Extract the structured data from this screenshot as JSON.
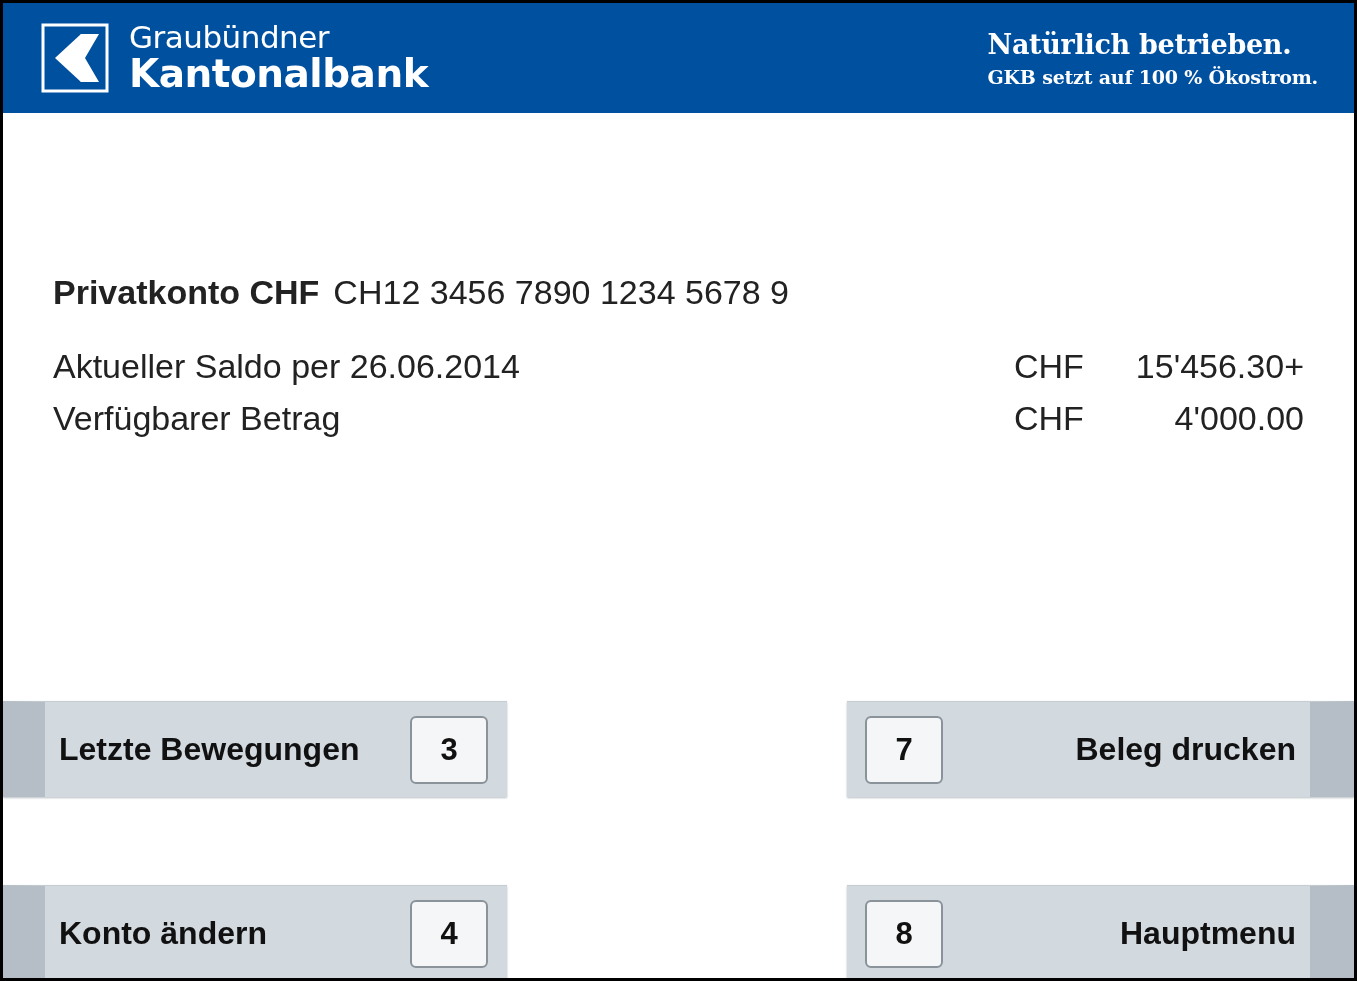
{
  "header": {
    "bank_name": [
      "Graubündner",
      "Kantonalbank"
    ],
    "slogan": "Natürlich betrieben.",
    "subline": "GKB setzt auf 100 % Ökostrom."
  },
  "account": {
    "name": "Privatkonto CHF",
    "iban": "CH12 3456 7890 1234 5678 9"
  },
  "balances": [
    {
      "label": "Aktueller Saldo per 26.06.2014",
      "currency": "CHF",
      "amount": "15'456.30+"
    },
    {
      "label": "Verfügbarer Betrag",
      "currency": "CHF",
      "amount": "4'000.00"
    }
  ],
  "buttons": [
    {
      "label": "Letzte Bewegungen",
      "key": "3",
      "kind": "left"
    },
    {
      "label": "Beleg drucken",
      "key": "7",
      "kind": "right"
    },
    {
      "label": "Konto ändern",
      "key": "4",
      "kind": "left"
    },
    {
      "label": "Hauptmenu",
      "key": "8",
      "kind": "right"
    }
  ]
}
